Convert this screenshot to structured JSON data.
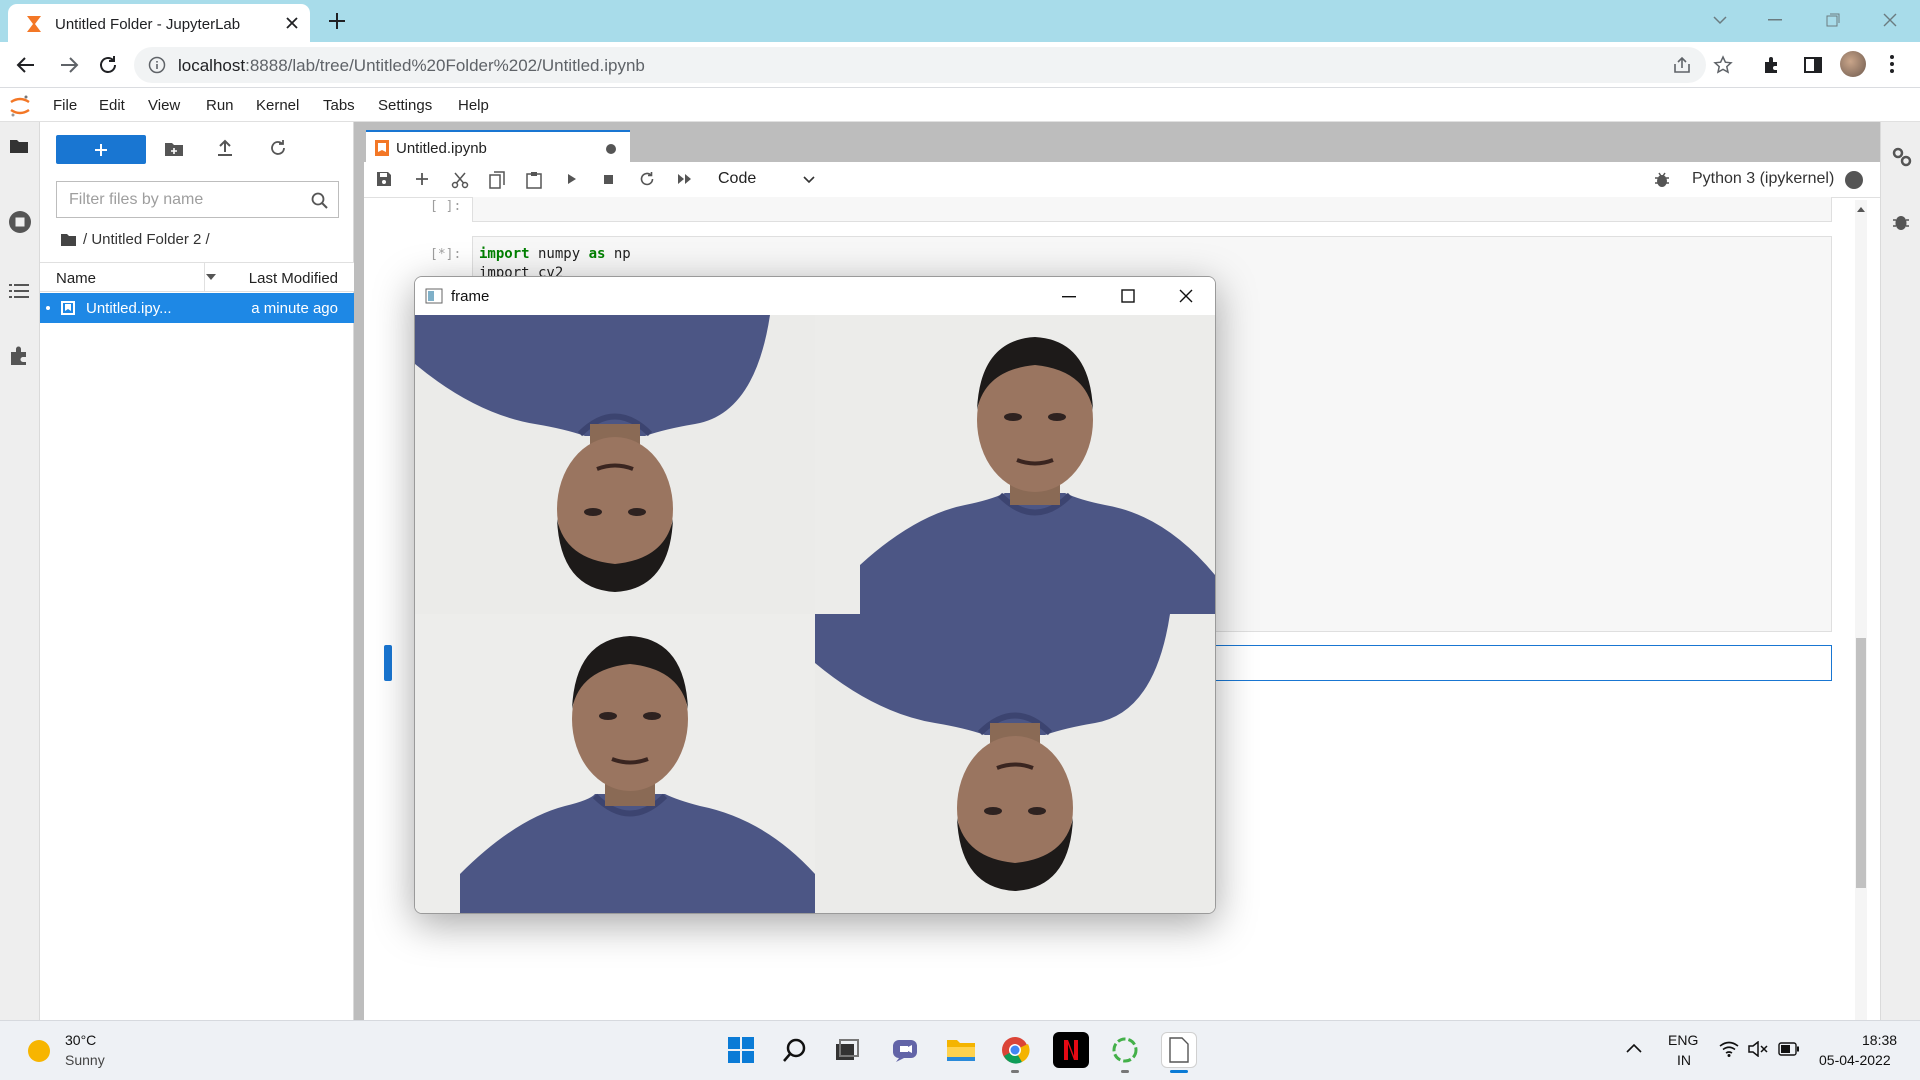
{
  "browser": {
    "tab_title": "Untitled Folder - JupyterLab",
    "url_host": "localhost",
    "url_rest": ":8888/lab/tree/Untitled%20Folder%202/Untitled.ipynb"
  },
  "menu": [
    "File",
    "Edit",
    "View",
    "Run",
    "Kernel",
    "Tabs",
    "Settings",
    "Help"
  ],
  "filebrowser": {
    "filter_placeholder": "Filter files by name",
    "breadcrumb": "/ Untitled Folder 2 /",
    "col_name": "Name",
    "col_modified": "Last Modified",
    "file_name": "Untitled.ipy...",
    "file_modified": "a minute ago"
  },
  "notebook": {
    "tab_title": "Untitled.ipynb",
    "cell_type": "Code",
    "kernel": "Python 3 (ipykernel)",
    "cell1_prompt": "[ ]:",
    "cell2_prompt": "[*]:",
    "cell2_line1_kw": "import",
    "cell2_line1_mid": " numpy ",
    "cell2_line1_kw2": "as",
    "cell2_line1_end": " np",
    "cell2_line2": "import cv2"
  },
  "frame_window": {
    "title": "frame"
  },
  "taskbar": {
    "weather_temp": "30°C",
    "weather_desc": "Sunny",
    "lang1": "ENG",
    "lang2": "IN",
    "time": "18:38",
    "date": "05-04-2022"
  },
  "colors": {
    "jupyter_blue": "#1976d2",
    "browser_tab_bg": "#a8dcea"
  }
}
